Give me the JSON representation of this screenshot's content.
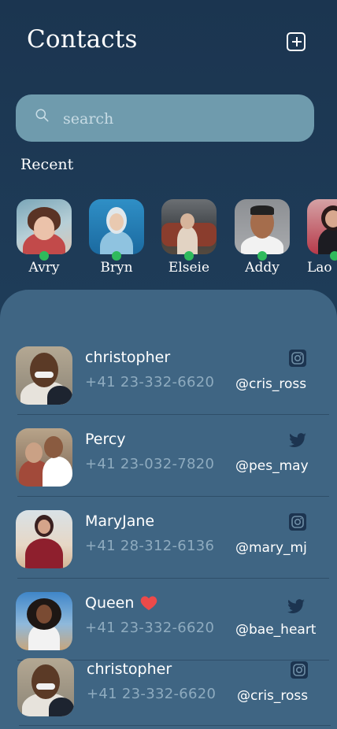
{
  "header": {
    "title": "Contacts"
  },
  "search": {
    "placeholder": "search"
  },
  "recent": {
    "label": "Recent",
    "items": [
      {
        "name": "Avry",
        "online": true
      },
      {
        "name": "Bryn",
        "online": true
      },
      {
        "name": "Elseie",
        "online": true
      },
      {
        "name": "Addy",
        "online": true
      },
      {
        "name": "Lao",
        "online": true
      }
    ]
  },
  "contacts": [
    {
      "name": "christopher",
      "phone": "+41 23-332-6620",
      "handle": "@cris_ross",
      "social": "instagram-icon"
    },
    {
      "name": "Percy",
      "phone": "+41 23-032-7820",
      "handle": "@pes_may",
      "social": "twitter-icon"
    },
    {
      "name": "MaryJane",
      "phone": "+41 28-312-6136",
      "handle": "@mary_mj",
      "social": "instagram-icon"
    },
    {
      "name": "Queen",
      "phone": "+41 23-332-6620",
      "handle": "@bae_heart",
      "social": "twitter-icon",
      "badge": "heart-icon"
    },
    {
      "name": "christopher",
      "phone": "+41 23-332-6620",
      "handle": "@cris_ross",
      "social": "instagram-icon"
    }
  ],
  "colors": {
    "background": "#1d3852",
    "panel": "#3f6583",
    "search": "#6f9bad",
    "online": "#2fba5c",
    "heart": "#ec4a4a"
  }
}
